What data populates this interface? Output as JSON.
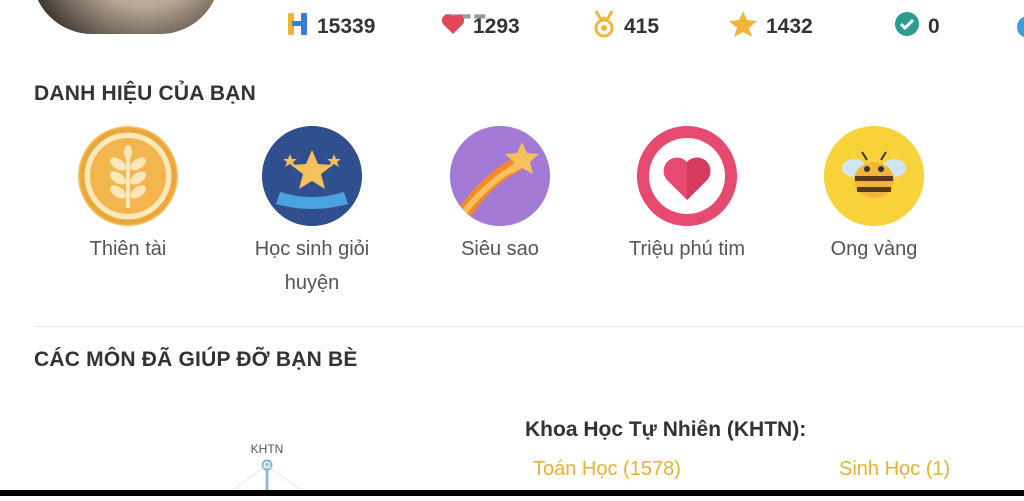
{
  "stats": [
    {
      "icon": "hoc-point-icon",
      "value": "15339"
    },
    {
      "icon": "heart-icon",
      "value": "1293"
    },
    {
      "icon": "medal-icon",
      "value": "415"
    },
    {
      "icon": "star-icon",
      "value": "1432"
    },
    {
      "icon": "check-badge-icon",
      "value": "0"
    }
  ],
  "badges_title": "DANH HIỆU CỦA BẠN",
  "badges": [
    {
      "label": "Thiên tài",
      "icon": "wheat-icon"
    },
    {
      "label": "Học sinh giỏi huyện",
      "icon": "stars-ribbon-icon"
    },
    {
      "label": "Siêu sao",
      "icon": "shooting-star-icon"
    },
    {
      "label": "Triệu phú tim",
      "icon": "heart-ring-icon"
    },
    {
      "label": "Ong vàng",
      "icon": "bee-icon"
    }
  ],
  "subjects_title": "CÁC MÔN ĐÃ GIÚP ĐỠ BẠN BÈ",
  "chart": {
    "top_label": "KHTN"
  },
  "subject_group": {
    "title": "Khoa Học Tự Nhiên (KHTN):",
    "items": [
      "Toán Học (1578)",
      "Sinh Học (1)"
    ]
  },
  "colors": {
    "accent": "#e8b12f",
    "heart": "#e0475b",
    "star": "#f2b53a",
    "check": "#2a9d8f"
  }
}
